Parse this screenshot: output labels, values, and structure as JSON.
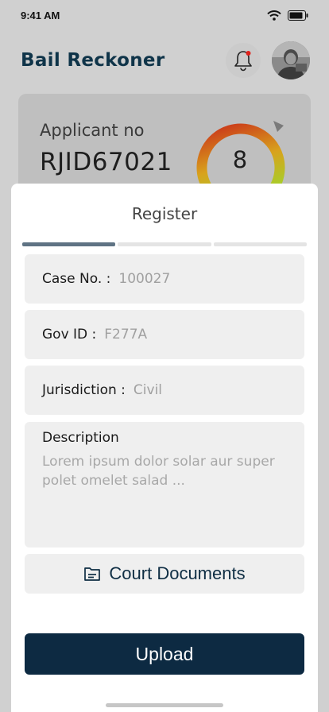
{
  "status_bar": {
    "time": "9:41 AM"
  },
  "header": {
    "title": "Bail Reckoner"
  },
  "applicant": {
    "label": "Applicant no",
    "id": "RJID67021",
    "score": "8"
  },
  "form": {
    "title": "Register",
    "progress_steps": 3,
    "active_step": 1,
    "fields": [
      {
        "label": "Case No. :",
        "value": "100027"
      },
      {
        "label": "Gov ID :",
        "value": "F277A"
      },
      {
        "label": "Jurisdiction :",
        "value": "Civil"
      }
    ],
    "description": {
      "label": "Description",
      "placeholder": "Lorem ipsum dolor solar aur super polet omelet salad ..."
    },
    "documents_label": "Court Documents",
    "upload_label": "Upload"
  },
  "colors": {
    "brand": "#0f3449",
    "button": "#0d2a42",
    "notification_dot": "#e0221b"
  },
  "icons": [
    "wifi-icon",
    "battery-icon",
    "bell-icon",
    "document-icon"
  ]
}
